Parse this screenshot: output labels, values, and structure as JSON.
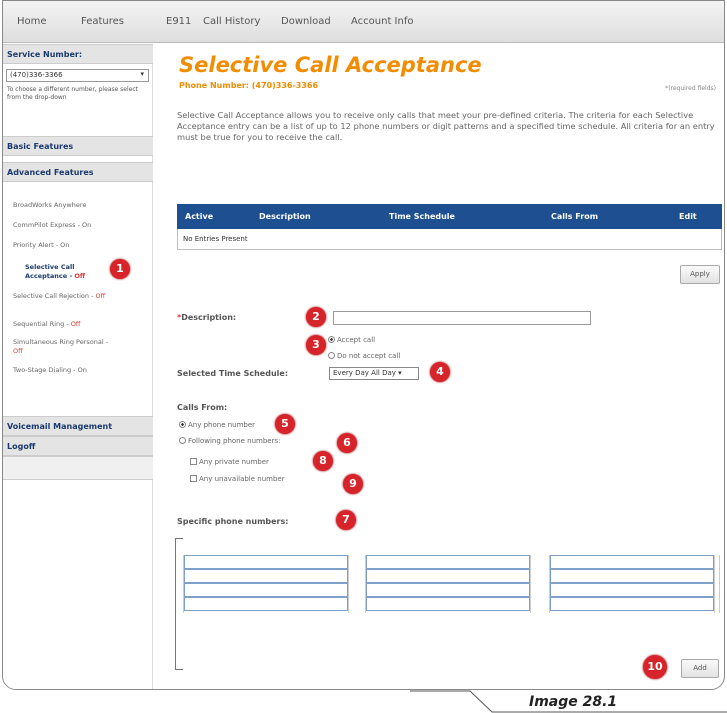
{
  "topnav": [
    "Home",
    "Features",
    "E911",
    "Call History",
    "Download",
    "Account Info"
  ],
  "sidebar": {
    "service_number_label": "Service Number:",
    "service_number_value": "(470)336-3366",
    "note": "To choose a different number, please select from the drop-down",
    "basic_features": "Basic Features",
    "advanced_features": "Advanced Features",
    "items": [
      {
        "label": "BroadWorks Anywhere",
        "status": ""
      },
      {
        "label": "CommPilot Express - ",
        "status": "On"
      },
      {
        "label": "Priority Alert - ",
        "status": "On"
      },
      {
        "label": "Selective Call Acceptance - ",
        "status": "Off"
      },
      {
        "label": "Selective Call Rejection - ",
        "status": "Off"
      },
      {
        "label": "Sequential Ring - ",
        "status": "Off"
      },
      {
        "label": "Simultaneous Ring Personal - ",
        "status": "Off"
      },
      {
        "label": "Two-Stage Dialing - ",
        "status": "On"
      }
    ],
    "voicemail": "Voicemail Management",
    "logoff": "Logoff"
  },
  "main": {
    "title": "Selective Call Acceptance",
    "phone_number": "Phone Number: (470)336-3366",
    "required_note": "*(required fields)",
    "description": "Selective Call Acceptance allows you to receive only calls that meet your pre-defined criteria. The criteria for each Selective Acceptance entry can be a list of up to 12 phone numbers or digit patterns and a specified time schedule. All criteria for an entry must be true for you to receive the call.",
    "table_headers": [
      "Active",
      "Description",
      "Time Schedule",
      "Calls From",
      "Edit"
    ],
    "table_empty": "No Entries Present",
    "apply_label": "Apply",
    "description_label": "Description:",
    "required_star": "*",
    "accept_call": "Accept call",
    "do_not_accept": "Do not accept call",
    "time_schedule_label": "Selected Time Schedule:",
    "time_schedule_value": "Every Day All Day",
    "calls_from_label": "Calls From:",
    "any_phone": "Any phone number",
    "following_numbers": "Following phone numbers:",
    "any_private": "Any private number",
    "any_unavailable": "Any unavailable number",
    "specific_label": "Specific phone numbers:",
    "add_label": "Add"
  },
  "callouts": [
    "1",
    "2",
    "3",
    "4",
    "5",
    "6",
    "7",
    "8",
    "9",
    "10"
  ],
  "caption": "Image 28.1",
  "colors": {
    "accent": "#f28c00",
    "header_blue": "#1d4f91",
    "callout_red": "#d7242b"
  }
}
